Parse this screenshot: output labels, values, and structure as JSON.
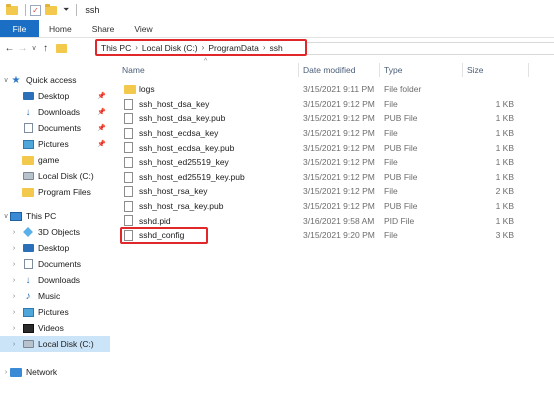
{
  "window": {
    "title": "ssh"
  },
  "ribbon": {
    "tabs": [
      "File",
      "Home",
      "Share",
      "View"
    ]
  },
  "address": {
    "crumbs": [
      "This PC",
      "Local Disk (C:)",
      "ProgramData",
      "ssh"
    ],
    "separator": "›"
  },
  "nav": {
    "quick_access": "Quick access",
    "items": [
      {
        "label": "Desktop"
      },
      {
        "label": "Downloads"
      },
      {
        "label": "Documents"
      },
      {
        "label": "Pictures"
      },
      {
        "label": "game"
      },
      {
        "label": "Local Disk (C:)"
      },
      {
        "label": "Program Files"
      }
    ],
    "this_pc": "This PC",
    "pc_items": [
      {
        "label": "3D Objects"
      },
      {
        "label": "Desktop"
      },
      {
        "label": "Documents"
      },
      {
        "label": "Downloads"
      },
      {
        "label": "Music"
      },
      {
        "label": "Pictures"
      },
      {
        "label": "Videos"
      },
      {
        "label": "Local Disk (C:)"
      }
    ],
    "network": "Network"
  },
  "columns": {
    "name": "Name",
    "date": "Date modified",
    "type": "Type",
    "size": "Size"
  },
  "files": [
    {
      "name": "logs",
      "date": "3/15/2021 9:11 PM",
      "type": "File folder",
      "size": ""
    },
    {
      "name": "ssh_host_dsa_key",
      "date": "3/15/2021 9:12 PM",
      "type": "File",
      "size": "1 KB"
    },
    {
      "name": "ssh_host_dsa_key.pub",
      "date": "3/15/2021 9:12 PM",
      "type": "PUB File",
      "size": "1 KB"
    },
    {
      "name": "ssh_host_ecdsa_key",
      "date": "3/15/2021 9:12 PM",
      "type": "File",
      "size": "1 KB"
    },
    {
      "name": "ssh_host_ecdsa_key.pub",
      "date": "3/15/2021 9:12 PM",
      "type": "PUB File",
      "size": "1 KB"
    },
    {
      "name": "ssh_host_ed25519_key",
      "date": "3/15/2021 9:12 PM",
      "type": "File",
      "size": "1 KB"
    },
    {
      "name": "ssh_host_ed25519_key.pub",
      "date": "3/15/2021 9:12 PM",
      "type": "PUB File",
      "size": "1 KB"
    },
    {
      "name": "ssh_host_rsa_key",
      "date": "3/15/2021 9:12 PM",
      "type": "File",
      "size": "2 KB"
    },
    {
      "name": "ssh_host_rsa_key.pub",
      "date": "3/15/2021 9:12 PM",
      "type": "PUB File",
      "size": "1 KB"
    },
    {
      "name": "sshd.pid",
      "date": "3/16/2021 9:58 AM",
      "type": "PID File",
      "size": "1 KB"
    },
    {
      "name": "sshd_config",
      "date": "3/15/2021 9:20 PM",
      "type": "File",
      "size": "3 KB"
    }
  ],
  "colors": {
    "accent": "#1a6fc4",
    "highlight": "#e0282a",
    "selected": "#cce4f7"
  }
}
